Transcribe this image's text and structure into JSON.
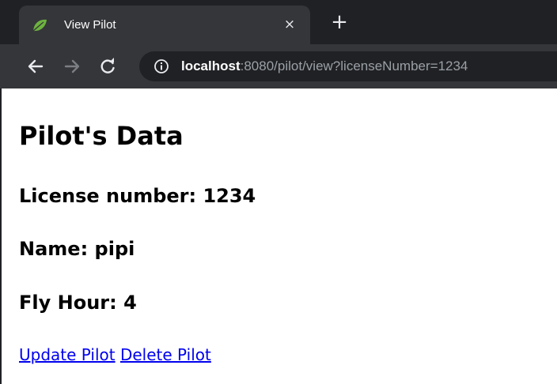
{
  "browser": {
    "tab_title": "View Pilot",
    "tab_close": "×",
    "new_tab": "+",
    "url_host": "localhost",
    "url_rest": ":8080/pilot/view?licenseNumber=1234"
  },
  "page": {
    "title": "Pilot's Data",
    "license_label": "License number: ",
    "license_number": "1234",
    "name_label": "Name: ",
    "name": "pipi",
    "fly_hour_label": "Fly Hour: ",
    "fly_hour": "4",
    "update_link": "Update Pilot",
    "delete_link": "Delete Pilot"
  },
  "colors": {
    "link": "#0000ee",
    "tabstrip": "#202124",
    "toolbar": "#35363a",
    "favicon": "#6db33f"
  },
  "icons": {
    "favicon": "leaf-icon",
    "back": "arrow-left-icon",
    "forward": "arrow-right-icon",
    "reload": "reload-icon",
    "site_info": "info-icon"
  }
}
